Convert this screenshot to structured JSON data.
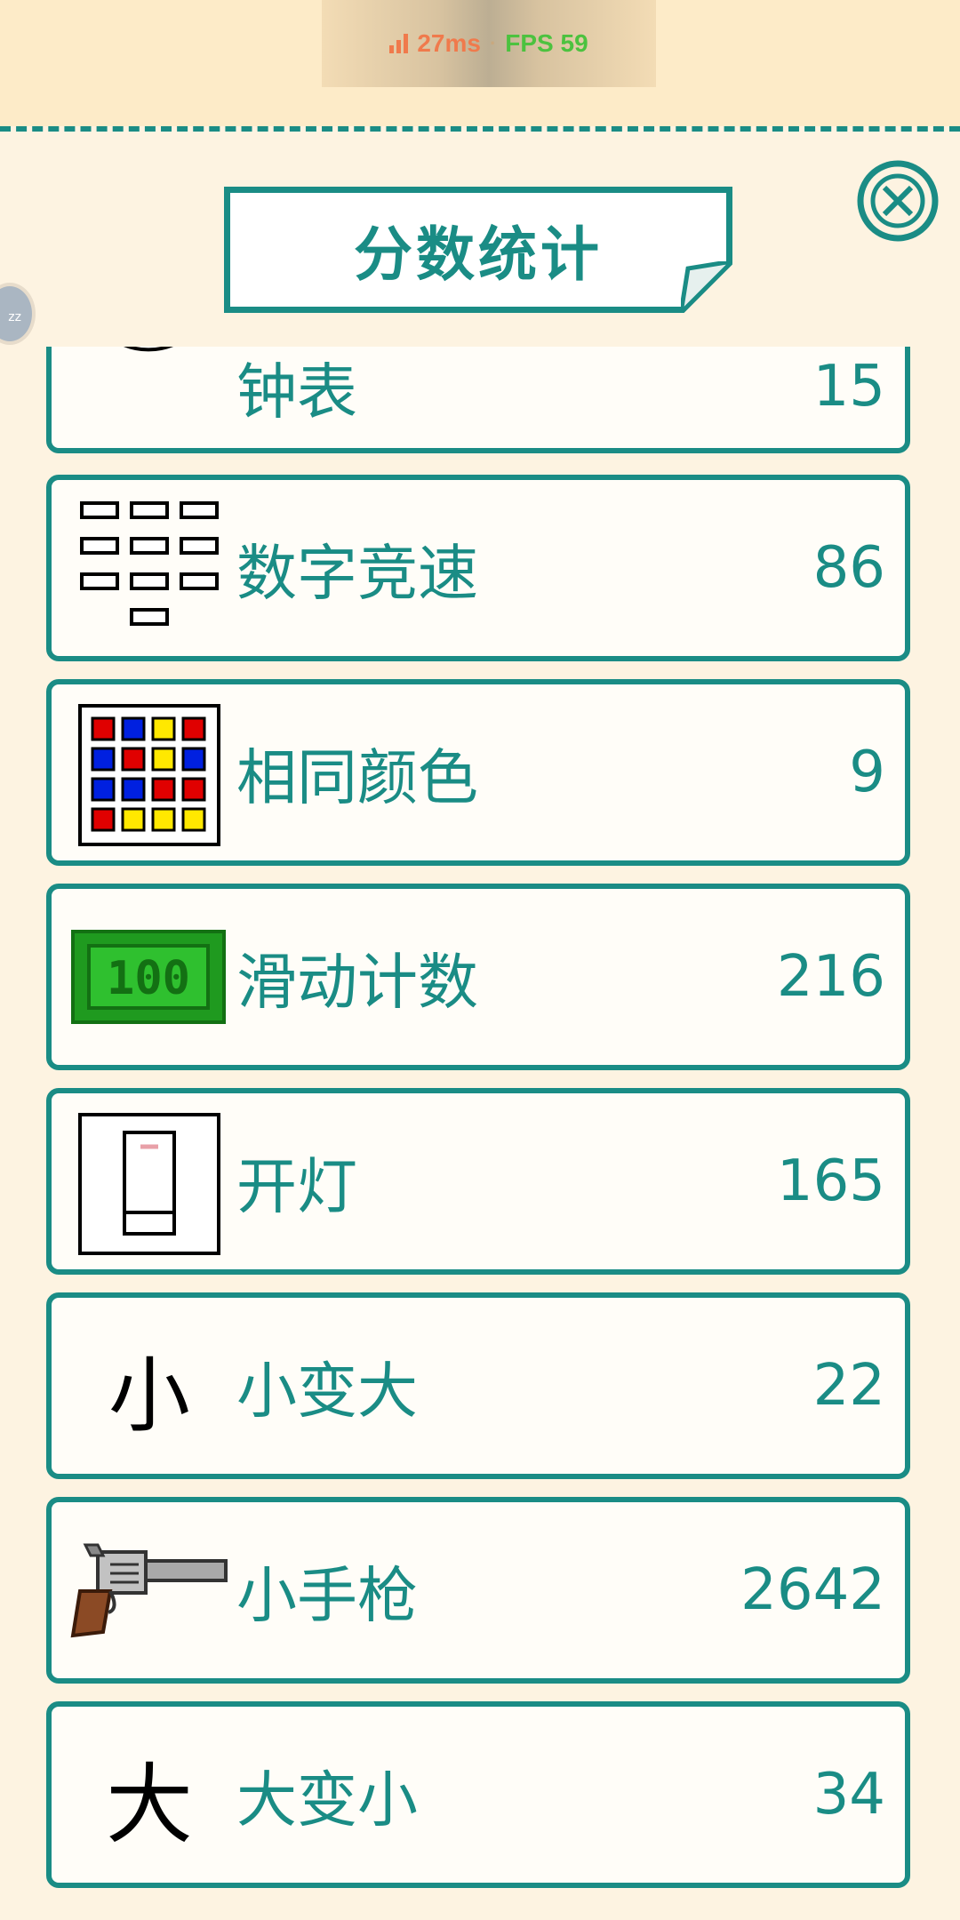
{
  "status": {
    "ping": "27ms",
    "separator": "·",
    "fps": "FPS 59",
    "ping_color": "#f07a4c",
    "fps_color": "#4cc23f"
  },
  "header": {
    "title": "分数统计",
    "close_icon": "close-icon"
  },
  "side_bubble": "zz",
  "colors": {
    "accent": "#1a8c85",
    "panel_bg": "#fdf3e1",
    "page_bg": "#fcecc9",
    "card_bg": "#fffdf8"
  },
  "scores": [
    {
      "icon": "clock-icon",
      "label": "钟表",
      "score": "15"
    },
    {
      "icon": "number-grid-icon",
      "label": "数字竞速",
      "score": "86"
    },
    {
      "icon": "color-grid-icon",
      "label": "相同颜色",
      "score": "9"
    },
    {
      "icon": "banknote-icon",
      "label": "滑动计数",
      "score": "216"
    },
    {
      "icon": "light-switch-icon",
      "label": "开灯",
      "score": "165"
    },
    {
      "icon": "small-char-icon",
      "label": "小变大",
      "score": "22"
    },
    {
      "icon": "revolver-icon",
      "label": "小手枪",
      "score": "2642"
    },
    {
      "icon": "big-char-icon",
      "label": "大变小",
      "score": "34"
    }
  ],
  "icon_glyphs": {
    "banknote": "100",
    "small_char": "小",
    "big_char": "大"
  }
}
